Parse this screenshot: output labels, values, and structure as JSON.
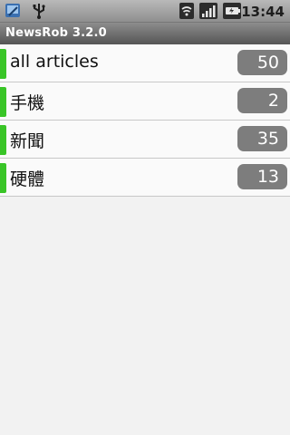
{
  "status_bar": {
    "time": "13:44",
    "left_icons": [
      "app-notification-icon",
      "usb-icon"
    ],
    "right_icons": [
      "wifi-icon",
      "signal-icon",
      "battery-charging-icon"
    ]
  },
  "title_bar": {
    "title": "NewsRob 3.2.0"
  },
  "list": {
    "items": [
      {
        "label": "all articles",
        "count": "50"
      },
      {
        "label": "手機",
        "count": "2"
      },
      {
        "label": "新聞",
        "count": "35"
      },
      {
        "label": "硬體",
        "count": "13"
      }
    ]
  },
  "colors": {
    "unread_indicator": "#39c527",
    "count_badge": "#7d7d7d"
  }
}
